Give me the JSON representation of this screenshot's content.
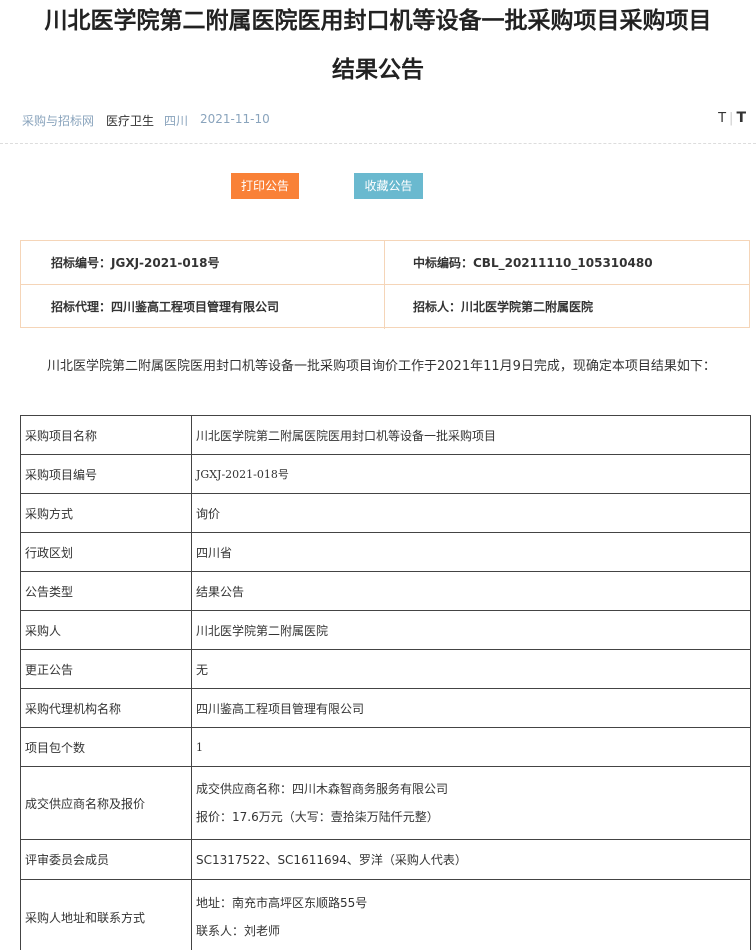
{
  "header": {
    "title_line1": "川北医学院第二附属医院医用封口机等设备一批采购项目采购项目",
    "title_line2": "结果公告"
  },
  "meta": {
    "site": "采购与招标网",
    "category": "医疗卫生",
    "region": "四川",
    "date": "2021-11-10",
    "font_small": "T",
    "font_sep": "|",
    "font_big": "T"
  },
  "actions": {
    "print_label": "打印公告",
    "favorite_label": "收藏公告"
  },
  "info": {
    "bid_no": "招标编号：JGXJ-2021-018号",
    "win_code": "中标编码：CBL_20211110_105310480",
    "agent": "招标代理：四川鉴高工程项目管理有限公司",
    "tenderer": "招标人：川北医学院第二附属医院"
  },
  "intro_text": "川北医学院第二附属医院医用封口机等设备一批采购项目询价工作于2021年11月9日完成，现确定本项目结果如下：",
  "table": {
    "rows": [
      {
        "k": "采购项目名称",
        "v": "川北医学院第二附属医院医用封口机等设备一批采购项目"
      },
      {
        "k": "采购项目编号",
        "v": "JGXJ-2021-018号"
      },
      {
        "k": "采购方式",
        "v": "询价"
      },
      {
        "k": "行政区划",
        "v": "四川省"
      },
      {
        "k": "公告类型",
        "v": "结果公告"
      },
      {
        "k": "采购人",
        "v": "川北医学院第二附属医院"
      },
      {
        "k": "更正公告",
        "v": "无"
      },
      {
        "k": "采购代理机构名称",
        "v": "四川鉴高工程项目管理有限公司"
      },
      {
        "k": "项目包个数",
        "v": "1"
      }
    ],
    "supplier": {
      "k": "成交供应商名称及报价",
      "v1": "成交供应商名称：四川木森智商务服务有限公司",
      "v2": "报价：17.6万元（大写：壹拾柒万陆仟元整）"
    },
    "committee": {
      "k": "评审委员会成员",
      "v": "SC1317522、SC1611694、罗洋（采购人代表）"
    },
    "contact": {
      "k": "采购人地址和联系方式",
      "v1": "地址：南充市高坪区东顺路55号",
      "v2": "联系人：刘老师"
    }
  }
}
